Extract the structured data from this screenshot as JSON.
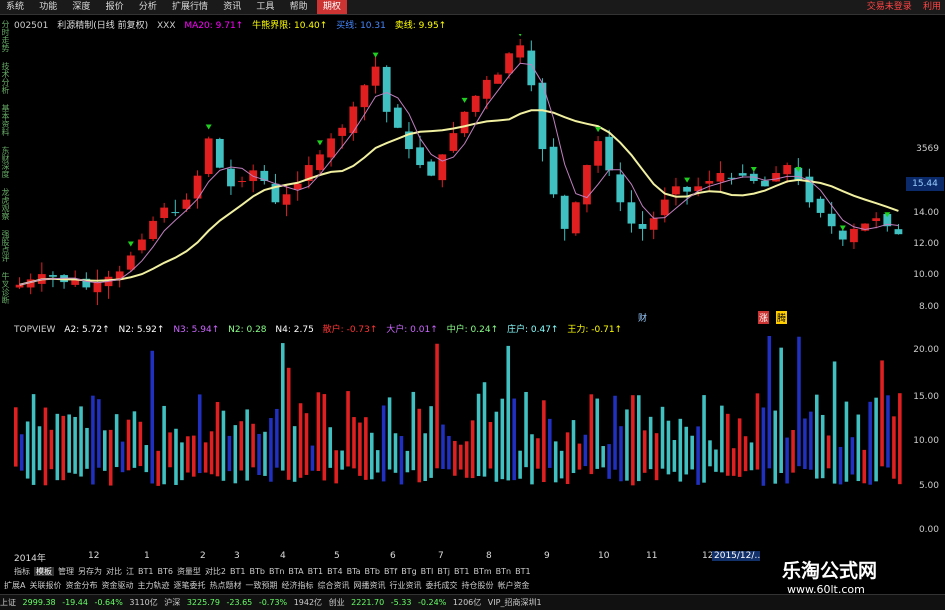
{
  "menu": {
    "items": [
      "系统",
      "功能",
      "深度",
      "报价",
      "分析",
      "扩展行情",
      "资讯",
      "工具",
      "帮助",
      "期权"
    ],
    "active_index": 9,
    "right_items": [
      "交易未登录",
      "利用"
    ]
  },
  "info": {
    "code": "002501",
    "name": "利源精制(日线 前复权)",
    "xxx": "XXX",
    "ma20": "MA20: 9.71↑",
    "bull": "牛熊界限: 10.40↑",
    "buy": "买线: 10.31",
    "sell": "卖线: 9.95↑"
  },
  "left_tabs": [
    "分时走势",
    "技术分析",
    "基本资料",
    "东财深度",
    "龙虎观察",
    "强股点评",
    "牛叉诊断"
  ],
  "price_axis": {
    "top_label": "3569",
    "current": "15.44",
    "ticks": [
      "12.00",
      "10.00",
      "8.00",
      "14.00",
      "12.00",
      "10.00",
      "8.00"
    ]
  },
  "price_axis_labels": [
    "14.00",
    "12.00",
    "10.00",
    "8.00"
  ],
  "markers": [
    "财",
    "涨",
    "腾"
  ],
  "indicator": {
    "name": "TOPVIEW",
    "a2": "A2: 5.72↑",
    "n2": "N2: 5.92↑",
    "n3": "N3: 5.94↑",
    "n2b": "N2: 0.28",
    "n4": "N4: 2.75",
    "sanhu": "散户: -0.73↑",
    "dahu": "大户: 0.01↑",
    "zhonghu": "中户: 0.24↑",
    "zhuanghu": "庄户: 0.47↑",
    "zhuli": "王力: -0.71↑"
  },
  "vol_axis": [
    "20.00",
    "15.00",
    "10.00",
    "5.00",
    "0.00"
  ],
  "dates": [
    "2014年",
    "12",
    "1",
    "2",
    "3",
    "4",
    "5",
    "6",
    "7",
    "8",
    "9",
    "10",
    "11",
    "12",
    "2015/12/…"
  ],
  "tabs1": [
    "指标",
    "模板",
    "管理",
    "另存为",
    "对比",
    "江",
    "BT1",
    "BT6",
    "资量型",
    "对比2",
    "BT1",
    "BTb",
    "BTn",
    "BTA",
    "BT1",
    "BT4",
    "BTa",
    "BTb",
    "BTf",
    "BTg",
    "BTI",
    "BTj",
    "BT1",
    "BTm",
    "BTn",
    "BT1"
  ],
  "tabs1_selected": 1,
  "tabs2": [
    "扩展A",
    "关联报价",
    "资金分布",
    "资金驱动",
    "主力轨迹",
    "逐笔委托",
    "热点题材",
    "一致预期",
    "经济指标",
    "综合资讯",
    "网播资讯",
    "行业资讯",
    "委托成交",
    "持仓股份",
    "帐户资金"
  ],
  "status": {
    "sh_label": "上证",
    "sh_val": "2999.38",
    "sh_chg": "-19.44",
    "sh_pct": "-0.64%",
    "sh_amt": "3110亿",
    "hs_label": "沪深",
    "hs_val": "3225.79",
    "hs_chg": "-23.65",
    "hs_pct": "-0.73%",
    "hs_amt": "1942亿",
    "cy_label": "创业",
    "cy_val": "2221.70",
    "cy_chg": "-5.33",
    "cy_pct": "-0.24%",
    "cy_amt": "1206亿",
    "vip": "VIP_招商深圳1"
  },
  "watermark": {
    "title": "乐淘公式网",
    "url": "www.60lt.com"
  },
  "colors": {
    "up": "#e02020",
    "down": "#40c0c0",
    "ma": "#f0f0a0",
    "ma2": "#c080c0",
    "vol_blue": "#2030c0",
    "green_arrow": "#20d020"
  },
  "chart_data": {
    "type": "candlestick",
    "ylim": [
      7,
      17
    ],
    "close_series": [
      8.1,
      8.3,
      8.5,
      8.4,
      8.2,
      8.3,
      8.0,
      8.2,
      8.4,
      8.6,
      9.2,
      9.8,
      10.5,
      11.0,
      10.8,
      11.3,
      12.2,
      13.6,
      12.5,
      11.8,
      12.0,
      12.4,
      12.0,
      11.2,
      11.5,
      11.9,
      12.6,
      13.0,
      13.6,
      14.0,
      14.8,
      15.6,
      16.3,
      14.6,
      14.0,
      13.2,
      12.6,
      12.2,
      13.0,
      13.8,
      14.6,
      15.2,
      15.8,
      16.0,
      16.8,
      17.1,
      15.6,
      13.2,
      11.5,
      10.2,
      11.2,
      12.6,
      13.5,
      12.4,
      11.2,
      10.4,
      10.2,
      10.6,
      11.3,
      11.8,
      11.6,
      11.8,
      12.0,
      12.3,
      12.1,
      12.2,
      12.0,
      11.8,
      12.3,
      12.6,
      12.0,
      11.2,
      10.8,
      10.3,
      9.8,
      10.2,
      10.4,
      10.6,
      10.3,
      10.0
    ]
  }
}
